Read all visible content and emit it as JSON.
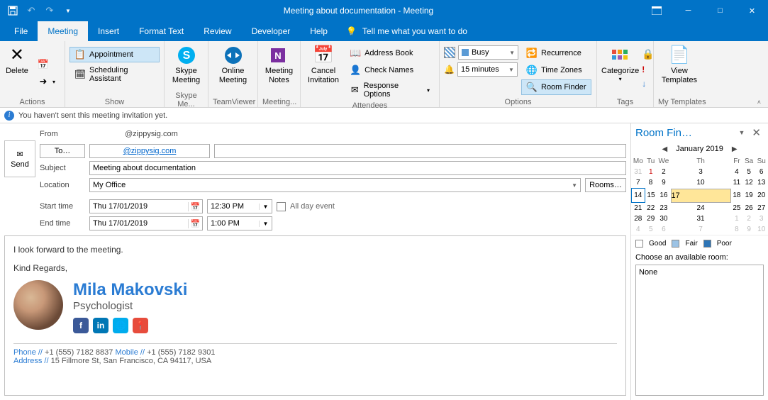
{
  "window": {
    "title": "Meeting about documentation  -  Meeting"
  },
  "qat": {
    "save": "💾",
    "undo": "↶",
    "redo": "↷",
    "more": "▾"
  },
  "menubar": {
    "file": "File",
    "meeting": "Meeting",
    "insert": "Insert",
    "formatText": "Format Text",
    "review": "Review",
    "developer": "Developer",
    "help": "Help",
    "tellMe": "Tell me what you want to do"
  },
  "ribbon": {
    "actions": {
      "label": "Actions",
      "delete": "Delete"
    },
    "show": {
      "label": "Show",
      "appointment": "Appointment",
      "scheduling": "Scheduling Assistant"
    },
    "skype": {
      "label": "Skype Me...",
      "btn": "Skype\nMeeting"
    },
    "teamviewer": {
      "label": "TeamViewer",
      "btn": "Online\nMeeting"
    },
    "meetingNotes": {
      "label": "Meeting...",
      "btn": "Meeting\nNotes"
    },
    "attendees": {
      "label": "Attendees",
      "cancel": "Cancel\nInvitation",
      "addressBook": "Address Book",
      "checkNames": "Check Names",
      "responseOptions": "Response Options"
    },
    "options": {
      "label": "Options",
      "busy": "Busy",
      "reminder": "15 minutes",
      "recurrence": "Recurrence",
      "timeZones": "Time Zones",
      "roomFinder": "Room Finder"
    },
    "tags": {
      "label": "Tags",
      "categorize": "Categorize"
    },
    "myTemplates": {
      "label": "My Templates",
      "view": "View\nTemplates"
    }
  },
  "info": {
    "text": "You haven't sent this meeting invitation yet."
  },
  "fields": {
    "send": "Send",
    "fromLabel": "From",
    "fromValue": "@zippysig.com",
    "toLabel": "To…",
    "toValue": "@zippysig.com",
    "subjectLabel": "Subject",
    "subjectValue": "Meeting about documentation",
    "locationLabel": "Location",
    "locationValue": "My Office",
    "roomsBtn": "Rooms…",
    "startLabel": "Start time",
    "startDate": "Thu 17/01/2019",
    "startTime": "12:30 PM",
    "endLabel": "End time",
    "endDate": "Thu 17/01/2019",
    "endTime": "1:00 PM",
    "allDay": "All day event"
  },
  "body": {
    "line1": "I look forward to the meeting.",
    "line2": "Kind Regards,",
    "sigName": "Mila Makovski",
    "sigTitle": "Psychologist",
    "phoneLabel": "Phone //",
    "phone": "+1 (555) 7182 8837",
    "mobileLabel": "Mobile //",
    "mobile": "+1 (555) 7182 9301",
    "addressLabel": "Address //",
    "address": "15 Fillmore St, San Francisco, CA 94117, USA"
  },
  "roomFinder": {
    "title": "Room Fin…",
    "month": "January 2019",
    "dow": [
      "Mo",
      "Tu",
      "We",
      "Th",
      "Fr",
      "Sa",
      "Su"
    ],
    "weeks": [
      [
        {
          "d": "31",
          "dim": true
        },
        {
          "d": "1",
          "red": true
        },
        {
          "d": "2"
        },
        {
          "d": "3"
        },
        {
          "d": "4"
        },
        {
          "d": "5"
        },
        {
          "d": "6"
        }
      ],
      [
        {
          "d": "7"
        },
        {
          "d": "8"
        },
        {
          "d": "9"
        },
        {
          "d": "10"
        },
        {
          "d": "11"
        },
        {
          "d": "12"
        },
        {
          "d": "13"
        }
      ],
      [
        {
          "d": "14",
          "today": true
        },
        {
          "d": "15"
        },
        {
          "d": "16"
        },
        {
          "d": "17",
          "sel": true
        },
        {
          "d": "18"
        },
        {
          "d": "19"
        },
        {
          "d": "20"
        }
      ],
      [
        {
          "d": "21"
        },
        {
          "d": "22"
        },
        {
          "d": "23"
        },
        {
          "d": "24"
        },
        {
          "d": "25"
        },
        {
          "d": "26"
        },
        {
          "d": "27"
        }
      ],
      [
        {
          "d": "28"
        },
        {
          "d": "29"
        },
        {
          "d": "30"
        },
        {
          "d": "31"
        },
        {
          "d": "1",
          "dim": true
        },
        {
          "d": "2",
          "dim": true
        },
        {
          "d": "3",
          "dim": true
        }
      ],
      [
        {
          "d": "4",
          "dim": true
        },
        {
          "d": "5",
          "dim": true
        },
        {
          "d": "6",
          "dim": true
        },
        {
          "d": "7",
          "dim": true
        },
        {
          "d": "8",
          "dim": true
        },
        {
          "d": "9",
          "dim": true
        },
        {
          "d": "10",
          "dim": true
        }
      ]
    ],
    "legend": {
      "good": "Good",
      "fair": "Fair",
      "poor": "Poor"
    },
    "chooseLabel": "Choose an available room:",
    "none": "None"
  }
}
